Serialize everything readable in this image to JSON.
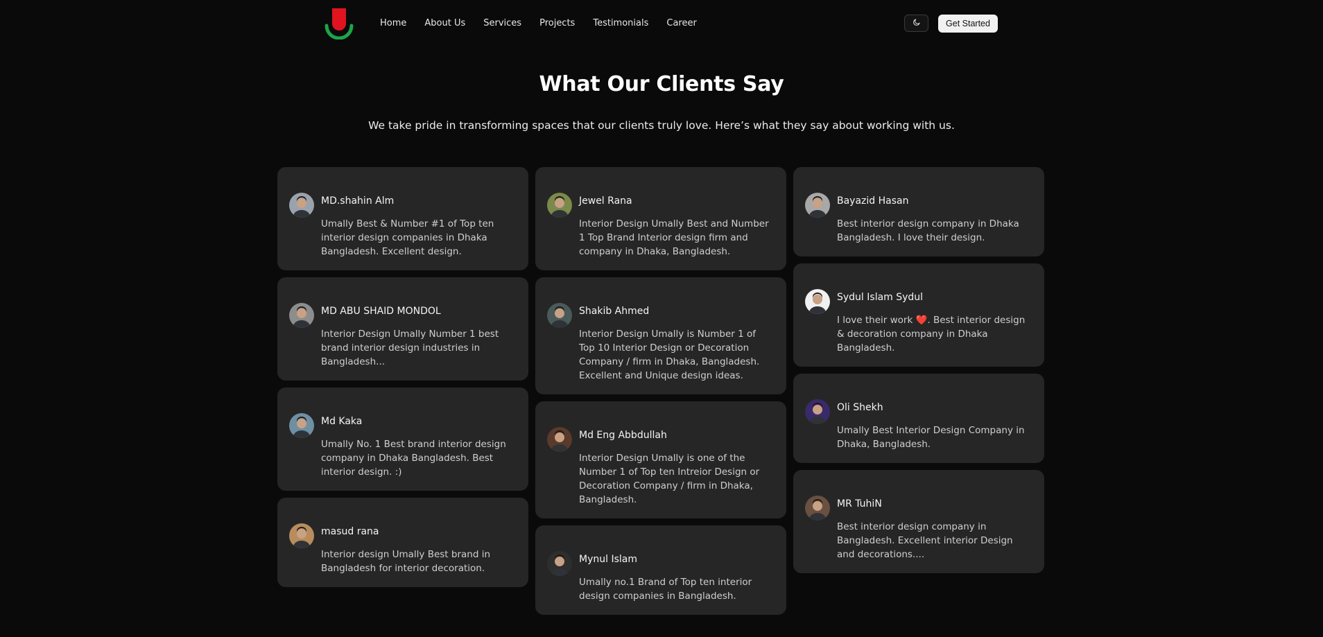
{
  "nav": {
    "logo_icon": "umally-logo",
    "links": [
      "Home",
      "About Us",
      "Services",
      "Projects",
      "Testimonials",
      "Career"
    ],
    "theme_icon": "moon-icon",
    "cta_label": "Get Started"
  },
  "header": {
    "title": "What Our Clients Say",
    "subtitle": "We take pride in transforming spaces that our clients truly love. Here’s what they say about working with us."
  },
  "testimonials": {
    "columns": [
      [
        {
          "name": "MD.shahin Alm",
          "text": "Umally Best & Number #1 of Top ten interior design companies in Dhaka Bangladesh. Excellent design.",
          "avatar_color": "#9aa3ad"
        },
        {
          "name": "MD ABU SHAID MONDOL",
          "text": "Interior Design Umally Number 1 best brand interior design industries in Bangladesh...",
          "avatar_color": "#8d8d8d"
        },
        {
          "name": "Md Kaka",
          "text": "Umally No. 1 Best brand interior design company in Dhaka Bangladesh. Best interior design. :)",
          "avatar_color": "#6f8fa3"
        },
        {
          "name": "masud rana",
          "text": "Interior design Umally Best brand in Bangladesh for interior decoration.",
          "avatar_color": "#b88c5c"
        }
      ],
      [
        {
          "name": "Jewel Rana",
          "text": "Interior Design Umally Best and Number 1 Top Brand Interior design firm and company in Dhaka, Bangladesh.",
          "avatar_color": "#7a8a4a"
        },
        {
          "name": "Shakib Ahmed",
          "text": "Interior Design Umally is Number 1 of Top 10 Interior Design or Decoration Company / firm in Dhaka, Bangladesh. Excellent and Unique design ideas.",
          "avatar_color": "#4a5a5a"
        },
        {
          "name": "Md Eng Abbdullah",
          "text": "Interior Design Umally is one of the Number 1 of Top ten Intreior Design or Decoration Company / firm in Dhaka, Bangladesh.",
          "avatar_color": "#5a3a2a"
        },
        {
          "name": "Mynul Islam",
          "text": "Umally no.1 Brand of Top ten interior design companies in Bangladesh.",
          "avatar_color": "#2e2e2e"
        }
      ],
      [
        {
          "name": "Bayazid Hasan",
          "text": "Best interior design company in Dhaka Bangladesh. I love their design.",
          "avatar_color": "#a8a8a8"
        },
        {
          "name": "Sydul Islam Sydul",
          "text": "I love their work ❤️. Best interior design & decoration company in Dhaka Bangladesh.",
          "avatar_color": "#f0f0f0"
        },
        {
          "name": "Oli Shekh",
          "text": "Umally Best Interior Design Company in Dhaka, Bangladesh.",
          "avatar_color": "#3a2a6a"
        },
        {
          "name": "MR TuhiN",
          "text": "Best interior design company in Bangladesh. Excellent interior Design and decorations....",
          "avatar_color": "#6a5040"
        }
      ]
    ]
  }
}
